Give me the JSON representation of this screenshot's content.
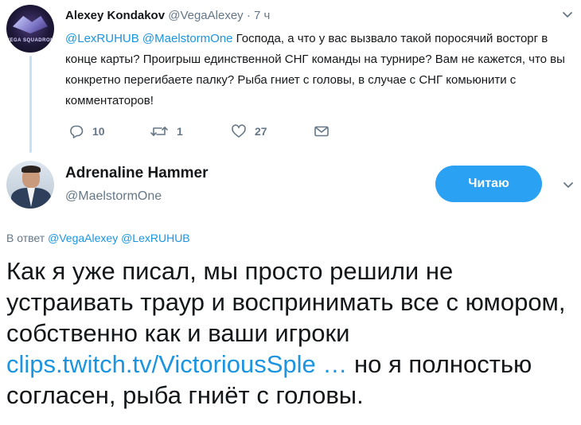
{
  "parent_tweet": {
    "author_name": "Alexey Kondakov",
    "author_handle": "@VegaAlexey",
    "separator": "·",
    "time": "7 ч",
    "avatar_caption": "VEGA SQUADRON",
    "mention1": "@LexRUHUB",
    "mention2": "@MaelstormOne",
    "text": " Господа, а что у вас вызвало такой поросячий восторг в конце карты? Проигрыш единственной СНГ команды на турнире? Вам не кажется, что вы конкретно перегибаете палку? Рыба гниет с головы, в случае с СНГ комьюнити с комментаторов!",
    "replies": "10",
    "retweets": "1",
    "likes": "27"
  },
  "main_tweet": {
    "author_name": "Adrenaline Hammer",
    "author_handle": "@MaelstormOne",
    "follow_label": "Читаю",
    "reply_prefix": "В ответ ",
    "reply_mention1": "@VegaAlexey",
    "reply_mention2": "@LexRUHUB",
    "text_part1": "Как я уже писал, мы просто решили не устраивать траур и воспринимать все с юмором, собственно как и ваши игроки ",
    "link": "clips.twitch.tv/VictoriousSple …",
    "text_part2": " но я полностью согласен, рыба гниёт с головы."
  },
  "colors": {
    "accent": "#1b95e0",
    "follow_button": "#2aa1f2",
    "secondary_text": "#657786",
    "thread_line": "#c4e1f5"
  },
  "icons": [
    "reply-icon",
    "retweet-icon",
    "like-icon",
    "direct-message-icon",
    "chevron-down-icon"
  ]
}
